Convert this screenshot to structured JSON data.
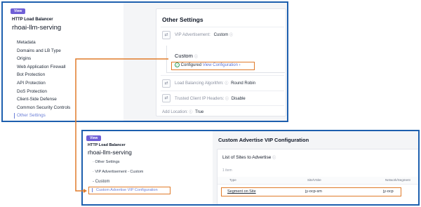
{
  "panel1": {
    "view_badge": "View",
    "resource_type": "HTTP Load Balancer",
    "resource_name": "rhoai-llm-serving",
    "nav": [
      "Metadata",
      "Domains and LB Type",
      "Origins",
      "Web Application Firewall",
      "Bot Protection",
      "API Protection",
      "DoS Protection",
      "Client-Side Defense",
      "Common Security Controls",
      "Other Settings"
    ],
    "card": {
      "title": "Other Settings",
      "vip_label": "VIP Advertisement:",
      "vip_value": "Custom",
      "custom_title": "Custom",
      "configured_text": "Configured",
      "configured_link": "View Configuration",
      "lb_label": "Load Balancing Algorithm:",
      "lb_value": "Round Robin",
      "trusted_label": "Trusted Client IP Headers:",
      "trusted_value": "Disable",
      "add_location_label": "Add Location:",
      "add_location_value": "True"
    }
  },
  "panel2": {
    "view_badge": "View",
    "resource_type": "HTTP Load Balancer",
    "resource_name": "rhoai-llm-serving",
    "nav": [
      "Other Settings",
      "VIP Advertisement - Custom",
      "Custom",
      "Custom Advertise VIP Configuration"
    ],
    "title": "Custom Advertise VIP Configuration",
    "card": {
      "title": "List of Sites to Advertise",
      "item_count": "1 item",
      "columns": [
        "Type",
        "Site/VSite",
        "Network/Segment"
      ],
      "row": [
        "Segment on Site",
        "jy-ocp-sm",
        "jy-ocp"
      ]
    }
  },
  "colors": {
    "frame_border": "#1d5fae",
    "highlight": "#e07b2a",
    "view_badge": "#6f5fd6",
    "link": "#5b73d6",
    "success": "#2f9e5a"
  }
}
